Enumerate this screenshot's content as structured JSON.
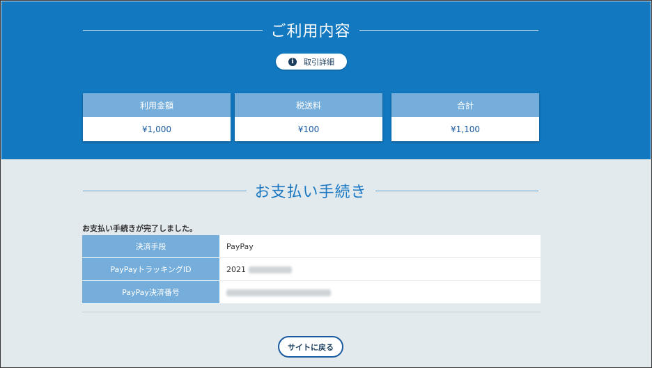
{
  "usage": {
    "title": "ご利用内容",
    "detail_button": "取引詳細",
    "cards": [
      {
        "label": "利用金額",
        "value": "¥1,000"
      },
      {
        "label": "税送料",
        "value": "¥100"
      },
      {
        "label": "合計",
        "value": "¥1,100"
      }
    ]
  },
  "payment": {
    "title": "お支払い手続き",
    "complete_message": "お支払い手続きが完了しました。",
    "rows": [
      {
        "label": "決済手段",
        "value": "PayPay"
      },
      {
        "label": "PayPayトラッキングID",
        "value": "2021"
      },
      {
        "label": "PayPay決済番号",
        "value": ""
      }
    ]
  },
  "back_button": "サイトに戻る"
}
